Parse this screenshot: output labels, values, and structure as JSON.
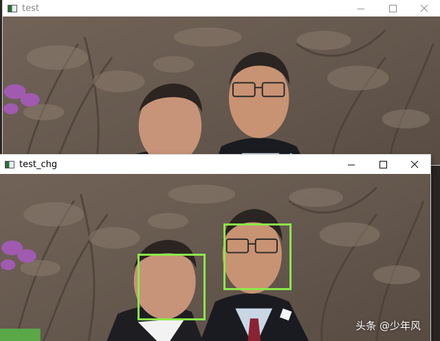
{
  "windows": [
    {
      "title": "test",
      "controls": {
        "minimize": "minimize-icon",
        "maximize": "maximize-icon",
        "close": "close-icon"
      }
    },
    {
      "title": "test_chg",
      "controls": {
        "minimize": "minimize-icon",
        "maximize": "maximize-icon",
        "close": "close-icon"
      },
      "detection_box_color": "#8de84a",
      "detections": 2
    }
  ],
  "watermark": "头条 @少年风"
}
